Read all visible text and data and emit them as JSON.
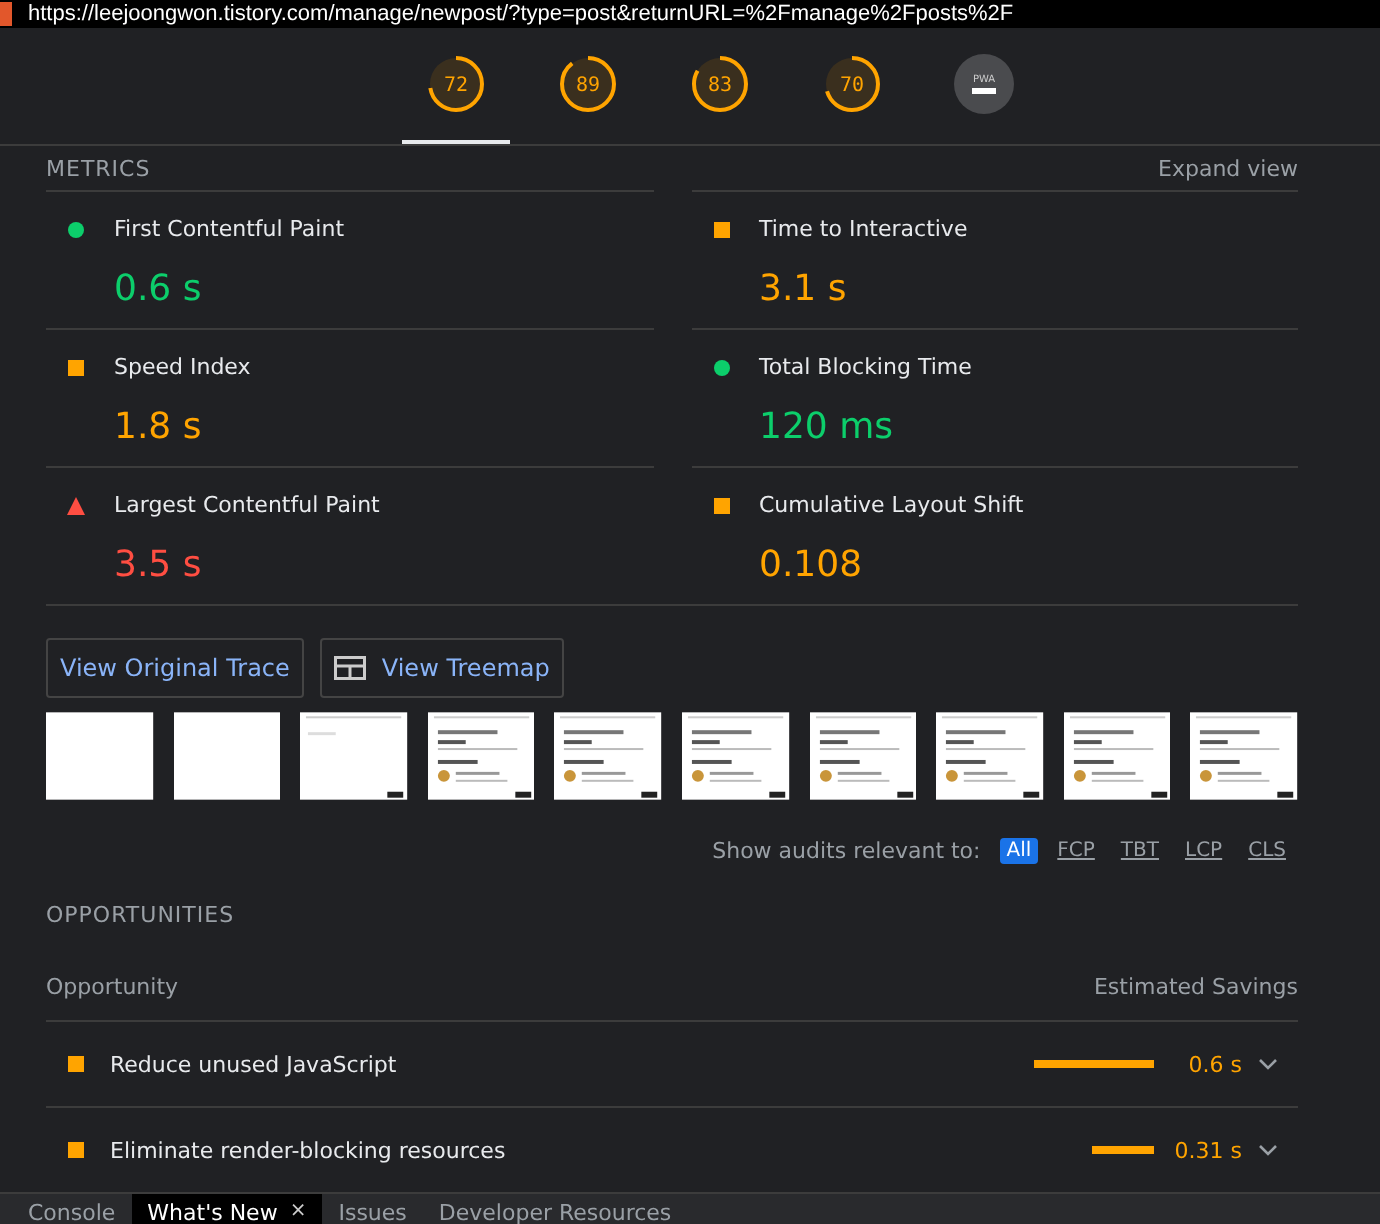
{
  "address_bar": {
    "url": "https://leejoongwon.tistory.com/manage/newpost/?type=post&returnURL=%2Fmanage%2Fposts%2F"
  },
  "gauges": [
    {
      "kind": "score",
      "score": "72",
      "selected": true
    },
    {
      "kind": "score",
      "score": "89",
      "selected": false
    },
    {
      "kind": "score",
      "score": "83",
      "selected": false
    },
    {
      "kind": "score",
      "score": "70",
      "selected": false
    },
    {
      "kind": "pwa",
      "score": "PWA",
      "selected": false
    }
  ],
  "metrics": {
    "title": "METRICS",
    "toggle": "Expand view",
    "items": [
      {
        "label": "First Contentful Paint",
        "value": "0.6 s",
        "kind": "pass"
      },
      {
        "label": "Time to Interactive",
        "value": "3.1 s",
        "kind": "average"
      },
      {
        "label": "Speed Index",
        "value": "1.8 s",
        "kind": "average"
      },
      {
        "label": "Total Blocking Time",
        "value": "120 ms",
        "kind": "pass"
      },
      {
        "label": "Largest Contentful Paint",
        "value": "3.5 s",
        "kind": "fail"
      },
      {
        "label": "Cumulative Layout Shift",
        "value": "0.108",
        "kind": "average"
      }
    ]
  },
  "buttons": [
    {
      "label": "View Original Trace",
      "kind": "text"
    },
    {
      "label": "View Treemap",
      "kind": "treemap"
    }
  ],
  "filmstrip": [
    {
      "kind": "blank"
    },
    {
      "kind": "blank"
    },
    {
      "kind": "loading"
    },
    {
      "kind": "page"
    },
    {
      "kind": "page"
    },
    {
      "kind": "page"
    },
    {
      "kind": "page"
    },
    {
      "kind": "page"
    },
    {
      "kind": "page"
    },
    {
      "kind": "page"
    }
  ],
  "audit_filter": {
    "label": "Show audits relevant to:",
    "options": [
      {
        "label": "All",
        "selected": true
      },
      {
        "label": "FCP",
        "selected": false
      },
      {
        "label": "TBT",
        "selected": false
      },
      {
        "label": "LCP",
        "selected": false
      },
      {
        "label": "CLS",
        "selected": false
      }
    ]
  },
  "opportunities": {
    "title": "OPPORTUNITIES",
    "column_1": "Opportunity",
    "column_2": "Estimated Savings",
    "rows": [
      {
        "label": "Reduce unused JavaScript",
        "savings": "0.6 s"
      },
      {
        "label": "Eliminate render-blocking resources",
        "savings": "0.31 s"
      }
    ]
  },
  "drawer_tabs": [
    {
      "label": "Console",
      "selected": false
    },
    {
      "label": "What's New",
      "selected": true,
      "close": "×"
    },
    {
      "label": "Issues",
      "selected": false
    },
    {
      "label": "Developer Resources",
      "selected": false
    }
  ]
}
